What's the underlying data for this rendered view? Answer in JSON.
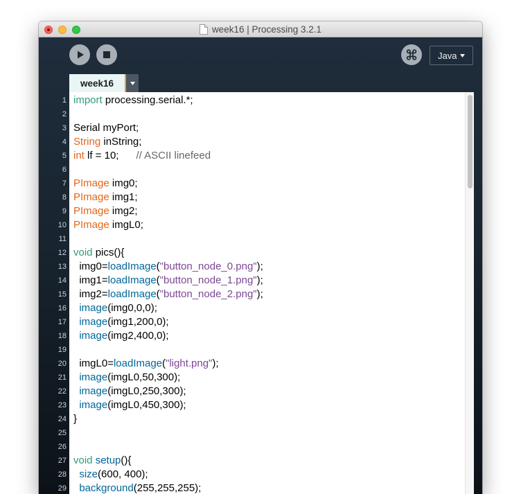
{
  "window": {
    "title": "week16 | Processing 3.2.1",
    "document_icon": "document-icon"
  },
  "toolbar": {
    "run_button": {
      "icon": "play-icon"
    },
    "stop_button": {
      "icon": "stop-icon"
    },
    "debug_button": {
      "icon": "debugger-icon"
    },
    "mode": {
      "label": "Java",
      "icon": "chevron-down-icon"
    }
  },
  "tabs": [
    {
      "label": "week16",
      "selected": true
    }
  ],
  "tab_menu": {
    "icon": "chevron-down-icon"
  },
  "editor": {
    "scroll_position": 0,
    "lines": [
      {
        "number": "1",
        "tokens": [
          {
            "text": "import",
            "style": "keyword"
          },
          {
            "text": " processing.serial.*;",
            "style": "plain"
          }
        ]
      },
      {
        "number": "2",
        "tokens": []
      },
      {
        "number": "3",
        "tokens": [
          {
            "text": "Serial myPort;",
            "style": "plain"
          }
        ]
      },
      {
        "number": "4",
        "tokens": [
          {
            "text": "String",
            "style": "type"
          },
          {
            "text": " inString;",
            "style": "plain"
          }
        ]
      },
      {
        "number": "5",
        "tokens": [
          {
            "text": "int",
            "style": "type"
          },
          {
            "text": " lf = 10;      ",
            "style": "plain"
          },
          {
            "text": "// ASCII linefeed",
            "style": "comment"
          }
        ]
      },
      {
        "number": "6",
        "tokens": []
      },
      {
        "number": "7",
        "tokens": [
          {
            "text": "PImage",
            "style": "type"
          },
          {
            "text": " img0;",
            "style": "plain"
          }
        ]
      },
      {
        "number": "8",
        "tokens": [
          {
            "text": "PImage",
            "style": "type"
          },
          {
            "text": " img1;",
            "style": "plain"
          }
        ]
      },
      {
        "number": "9",
        "tokens": [
          {
            "text": "PImage",
            "style": "type"
          },
          {
            "text": " img2;",
            "style": "plain"
          }
        ]
      },
      {
        "number": "10",
        "tokens": [
          {
            "text": "PImage",
            "style": "type"
          },
          {
            "text": " imgL0;",
            "style": "plain"
          }
        ]
      },
      {
        "number": "11",
        "tokens": []
      },
      {
        "number": "12",
        "tokens": [
          {
            "text": "void",
            "style": "keyword"
          },
          {
            "text": " pics(){",
            "style": "plain"
          }
        ]
      },
      {
        "number": "13",
        "tokens": [
          {
            "text": "  img0=",
            "style": "plain"
          },
          {
            "text": "loadImage",
            "style": "function"
          },
          {
            "text": "(",
            "style": "plain"
          },
          {
            "text": "\"button_node_0.png\"",
            "style": "string"
          },
          {
            "text": ");",
            "style": "plain"
          }
        ]
      },
      {
        "number": "14",
        "tokens": [
          {
            "text": "  img1=",
            "style": "plain"
          },
          {
            "text": "loadImage",
            "style": "function"
          },
          {
            "text": "(",
            "style": "plain"
          },
          {
            "text": "\"button_node_1.png\"",
            "style": "string"
          },
          {
            "text": ");",
            "style": "plain"
          }
        ]
      },
      {
        "number": "15",
        "tokens": [
          {
            "text": "  img2=",
            "style": "plain"
          },
          {
            "text": "loadImage",
            "style": "function"
          },
          {
            "text": "(",
            "style": "plain"
          },
          {
            "text": "\"button_node_2.png\"",
            "style": "string"
          },
          {
            "text": ");",
            "style": "plain"
          }
        ]
      },
      {
        "number": "16",
        "tokens": [
          {
            "text": "  ",
            "style": "plain"
          },
          {
            "text": "image",
            "style": "function"
          },
          {
            "text": "(img0,0,0);",
            "style": "plain"
          }
        ]
      },
      {
        "number": "17",
        "tokens": [
          {
            "text": "  ",
            "style": "plain"
          },
          {
            "text": "image",
            "style": "function"
          },
          {
            "text": "(img1,200,0);",
            "style": "plain"
          }
        ]
      },
      {
        "number": "18",
        "tokens": [
          {
            "text": "  ",
            "style": "plain"
          },
          {
            "text": "image",
            "style": "function"
          },
          {
            "text": "(img2,400,0);",
            "style": "plain"
          }
        ]
      },
      {
        "number": "19",
        "tokens": []
      },
      {
        "number": "20",
        "tokens": [
          {
            "text": "  imgL0=",
            "style": "plain"
          },
          {
            "text": "loadImage",
            "style": "function"
          },
          {
            "text": "(",
            "style": "plain"
          },
          {
            "text": "\"light.png\"",
            "style": "string"
          },
          {
            "text": ");",
            "style": "plain"
          }
        ]
      },
      {
        "number": "21",
        "tokens": [
          {
            "text": "  ",
            "style": "plain"
          },
          {
            "text": "image",
            "style": "function"
          },
          {
            "text": "(imgL0,50,300);",
            "style": "plain"
          }
        ]
      },
      {
        "number": "22",
        "tokens": [
          {
            "text": "  ",
            "style": "plain"
          },
          {
            "text": "image",
            "style": "function"
          },
          {
            "text": "(imgL0,250,300);",
            "style": "plain"
          }
        ]
      },
      {
        "number": "23",
        "tokens": [
          {
            "text": "  ",
            "style": "plain"
          },
          {
            "text": "image",
            "style": "function"
          },
          {
            "text": "(imgL0,450,300);",
            "style": "plain"
          }
        ]
      },
      {
        "number": "24",
        "tokens": [
          {
            "text": "}",
            "style": "plain"
          }
        ]
      },
      {
        "number": "25",
        "tokens": []
      },
      {
        "number": "26",
        "tokens": []
      },
      {
        "number": "27",
        "tokens": [
          {
            "text": "void",
            "style": "keyword"
          },
          {
            "text": " ",
            "style": "plain"
          },
          {
            "text": "setup",
            "style": "function"
          },
          {
            "text": "(){",
            "style": "plain"
          }
        ]
      },
      {
        "number": "28",
        "tokens": [
          {
            "text": "  ",
            "style": "plain"
          },
          {
            "text": "size",
            "style": "function"
          },
          {
            "text": "(600, 400);",
            "style": "plain"
          }
        ]
      },
      {
        "number": "29",
        "tokens": [
          {
            "text": "  ",
            "style": "plain"
          },
          {
            "text": "background",
            "style": "function"
          },
          {
            "text": "(255,255,255);",
            "style": "plain"
          }
        ]
      }
    ]
  },
  "syntax_colors": {
    "plain": "#000000",
    "keyword": "#33997e",
    "type": "#e2661a",
    "function": "#006699",
    "string": "#7d4793",
    "comment": "#666666"
  }
}
